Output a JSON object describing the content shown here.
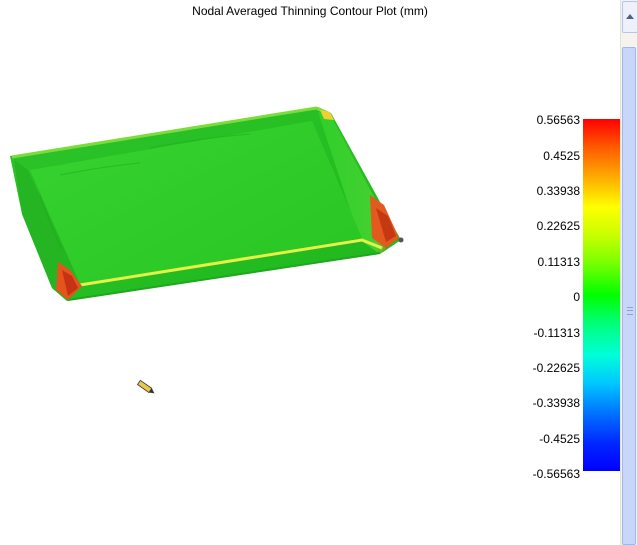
{
  "plot": {
    "title": "Nodal Averaged Thinning Contour Plot (mm)"
  },
  "legend": {
    "values": [
      "0.56563",
      "0.4525",
      "0.33938",
      "0.22625",
      "0.11313",
      "0",
      "-0.11313",
      "-0.22625",
      "-0.33938",
      "-0.4525",
      "-0.56563"
    ],
    "color_top": "#ff0000",
    "color_middle": "#00ff00",
    "color_bottom": "#0000ff"
  },
  "model": {
    "dominant_color": "#22c81e",
    "edge_color": "#f0f040",
    "thinning_hotspot_color": "#e83a1a"
  },
  "cursor": {
    "icon": "pencil-icon"
  },
  "scrollbar": {
    "icon": "scroll-up-arrow-icon"
  }
}
